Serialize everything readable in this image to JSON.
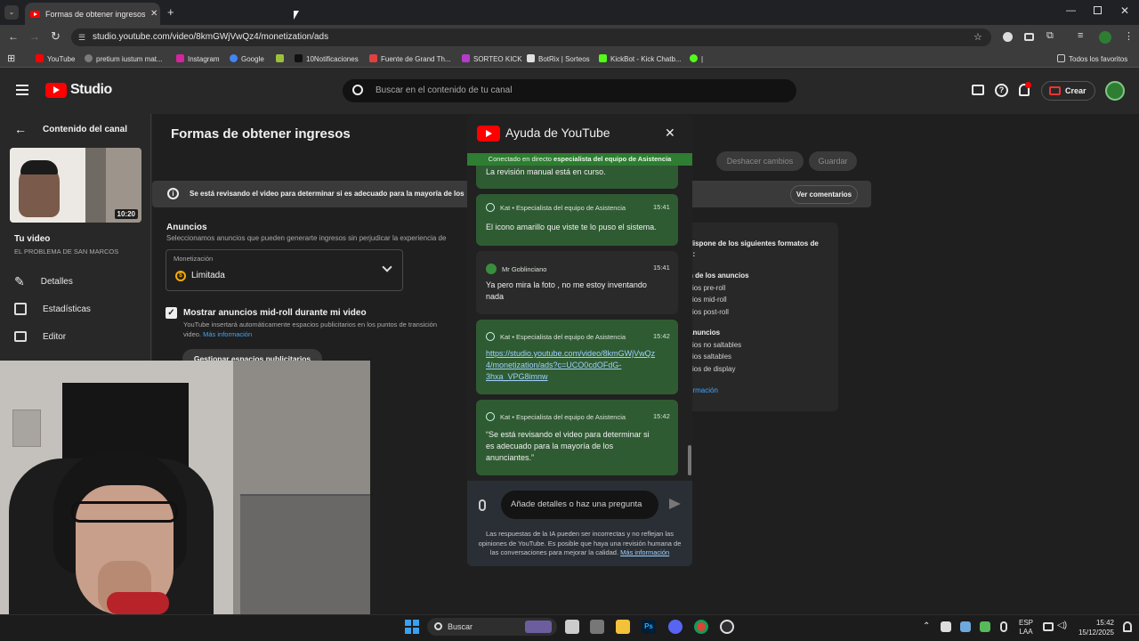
{
  "browser": {
    "tab_title": "Formas de obtener ingresos - Y",
    "url": "studio.youtube.com/video/8kmGWjVwQz4/monetization/ads",
    "bookmarks": [
      {
        "label": "YouTube",
        "color": "#ff0000"
      },
      {
        "label": "pretium iustum mat...",
        "color": "#7b7b7b"
      },
      {
        "label": "Instagram",
        "color": "#d6249f"
      },
      {
        "label": "Google",
        "color": "#4285f4"
      },
      {
        "label": "",
        "color": "#9bc13c"
      },
      {
        "label": "10Notificaciones",
        "color": "#111111"
      },
      {
        "label": "Fuente de Grand Th...",
        "color": "#e04040"
      },
      {
        "label": "SORTEO KICK",
        "color": "#b43cc8"
      },
      {
        "label": "BotRix | Sorteos",
        "color": "#e0e0e0"
      },
      {
        "label": "KickBot - Kick Chatb...",
        "color": "#53fc18"
      },
      {
        "label": "|",
        "color": "#53fc18"
      }
    ],
    "all_bookmarks": "Todos los favoritos"
  },
  "studio": {
    "logo": "Studio",
    "search_placeholder": "Buscar en el contenido de tu canal",
    "create_label": "Crear"
  },
  "sidebar": {
    "back_label": "Contenido del canal",
    "duration": "10:20",
    "your_video": "Tu video",
    "video_title": "EL PROBLEMA DE SAN MARCOS",
    "items": [
      {
        "label": "Detalles",
        "icon": "pencil-icon"
      },
      {
        "label": "Estadísticas",
        "icon": "chart-icon"
      },
      {
        "label": "Editor",
        "icon": "editor-icon"
      }
    ]
  },
  "main": {
    "page_title": "Formas de obtener ingresos",
    "undo_label": "Deshacer cambios",
    "save_label": "Guardar",
    "banner_text": "Se está revisando el video para determinar si es adecuado para la mayoría de los",
    "banner_button": "Ver comentarios",
    "ads_heading": "Anuncios",
    "ads_sub": "Seleccionamos anuncios que pueden generarte ingresos sin perjudicar la experiencia de",
    "monetization_label": "Monetización",
    "monetization_value": "Limitada",
    "midroll_label": "Mostrar anuncios mid-roll durante mi video",
    "midroll_desc_1": "YouTube insertará automáticamente espacios publicitarios en los puntos de transición",
    "midroll_desc_2": "video.",
    "more_info": "Más información",
    "manage_button": "Gestionar espacios publicitarios",
    "right_card": {
      "line1": "dispone de los siguientes formatos de",
      "line2": "s:",
      "section1": "n de los anuncios",
      "items1": [
        "cios pre-roll",
        "cios mid-roll",
        "cios post-roll"
      ],
      "section2": "anuncios",
      "items2": [
        "cios no saltables",
        "cios saltables",
        "cios de display"
      ],
      "link": "ormación"
    }
  },
  "help": {
    "title": "Ayuda de YouTube",
    "status_prefix": "Conectado en directo ",
    "status_bold": "especialista del equipo de Asistencia",
    "partial_msg": "La revisión manual está en curso.",
    "messages": [
      {
        "author": "Kat • Especialista del equipo de Asistencia",
        "time": "15:41",
        "lines": [
          "El icono amarillo que viste te lo puso el sistema."
        ]
      },
      {
        "author": "Mr Goblinciano",
        "time": "15:41",
        "lines": [
          "Ya pero mira la foto , no me estoy inventando",
          "nada"
        ]
      },
      {
        "author": "Kat • Especialista del equipo de Asistencia",
        "time": "15:42",
        "lines": [
          "https://studio.youtube.com/video/8kmGWjVwQz",
          "4/monetization/ads?c=UCO0cdOFdG-",
          "3hxa_VPG8imnw"
        ]
      },
      {
        "author": "Kat • Especialista del equipo de Asistencia",
        "time": "15:42",
        "lines": [
          "“Se está revisando el video para determinar si",
          "es adecuado para la mayoría de los",
          "anunciantes.”"
        ]
      }
    ],
    "input_placeholder": "Añade detalles o haz una pregunta",
    "disclaimer_1": "Las respuestas de la IA pueden ser incorrectas y no reflejan las",
    "disclaimer_2": "opiniones de YouTube. Es posible que haya una revisión humana de",
    "disclaimer_3": "las conversaciones para mejorar la calidad.",
    "disclaimer_link": "Más información"
  },
  "taskbar": {
    "search": "Buscar",
    "lang1": "ESP",
    "lang2": "LAA",
    "time": "15:42",
    "date": "15/12/2025"
  }
}
